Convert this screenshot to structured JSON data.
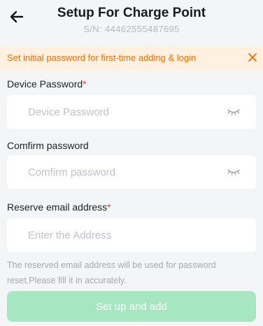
{
  "header": {
    "title": "Setup For Charge Point",
    "serial": "S/N: 44462555487695"
  },
  "banner": {
    "text": "Set initial password for first-time adding & login",
    "color": "#ff6a00",
    "background": "#fff1e1"
  },
  "form": {
    "device_password": {
      "label": "Device Password",
      "required_mark": "*",
      "placeholder": "Device Password",
      "value": ""
    },
    "confirm_password": {
      "label": "Comfirm password",
      "placeholder": "Comfirm password",
      "value": ""
    },
    "email": {
      "label": "Reserve email address",
      "required_mark": "*",
      "placeholder": "Enter the Address",
      "value": ""
    },
    "hint": "The reserved email address will be used for password reset.Please fill it in accurately."
  },
  "submit": {
    "label": "Set up and add",
    "color": "#a6e7c2"
  },
  "icons": {
    "back": "back-arrow-icon",
    "close": "close-icon",
    "visibility": "eye-closed-icon"
  }
}
